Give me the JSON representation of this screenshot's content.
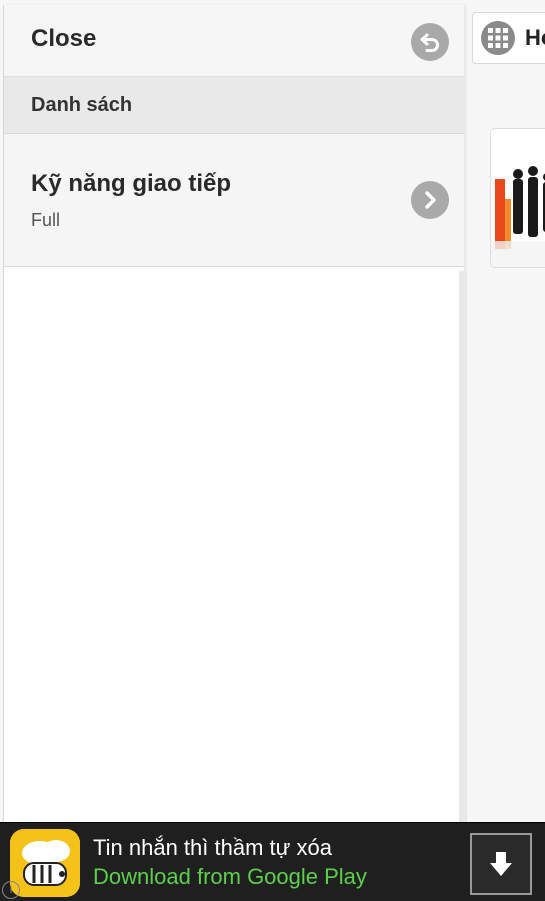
{
  "background_app": {
    "title": "Ho",
    "icons": {
      "grid": "grid-icon"
    }
  },
  "panel": {
    "close_label": "Close",
    "close_icon": "undo-arrow-icon",
    "section_label": "Danh sách",
    "items": [
      {
        "title": "Kỹ năng giao tiếp",
        "subtitle": "Full",
        "icon": "chevron-right-icon"
      }
    ]
  },
  "ad": {
    "title": "Tin nhắn thì thầm tự xóa",
    "subtitle": "Download from Google Play",
    "info_label": "i",
    "logo_icon": "app-logo-icon",
    "download_icon": "download-arrow-icon",
    "colors": {
      "subtitle": "#5cd04a",
      "logo_bg": "#f5c21a"
    }
  }
}
